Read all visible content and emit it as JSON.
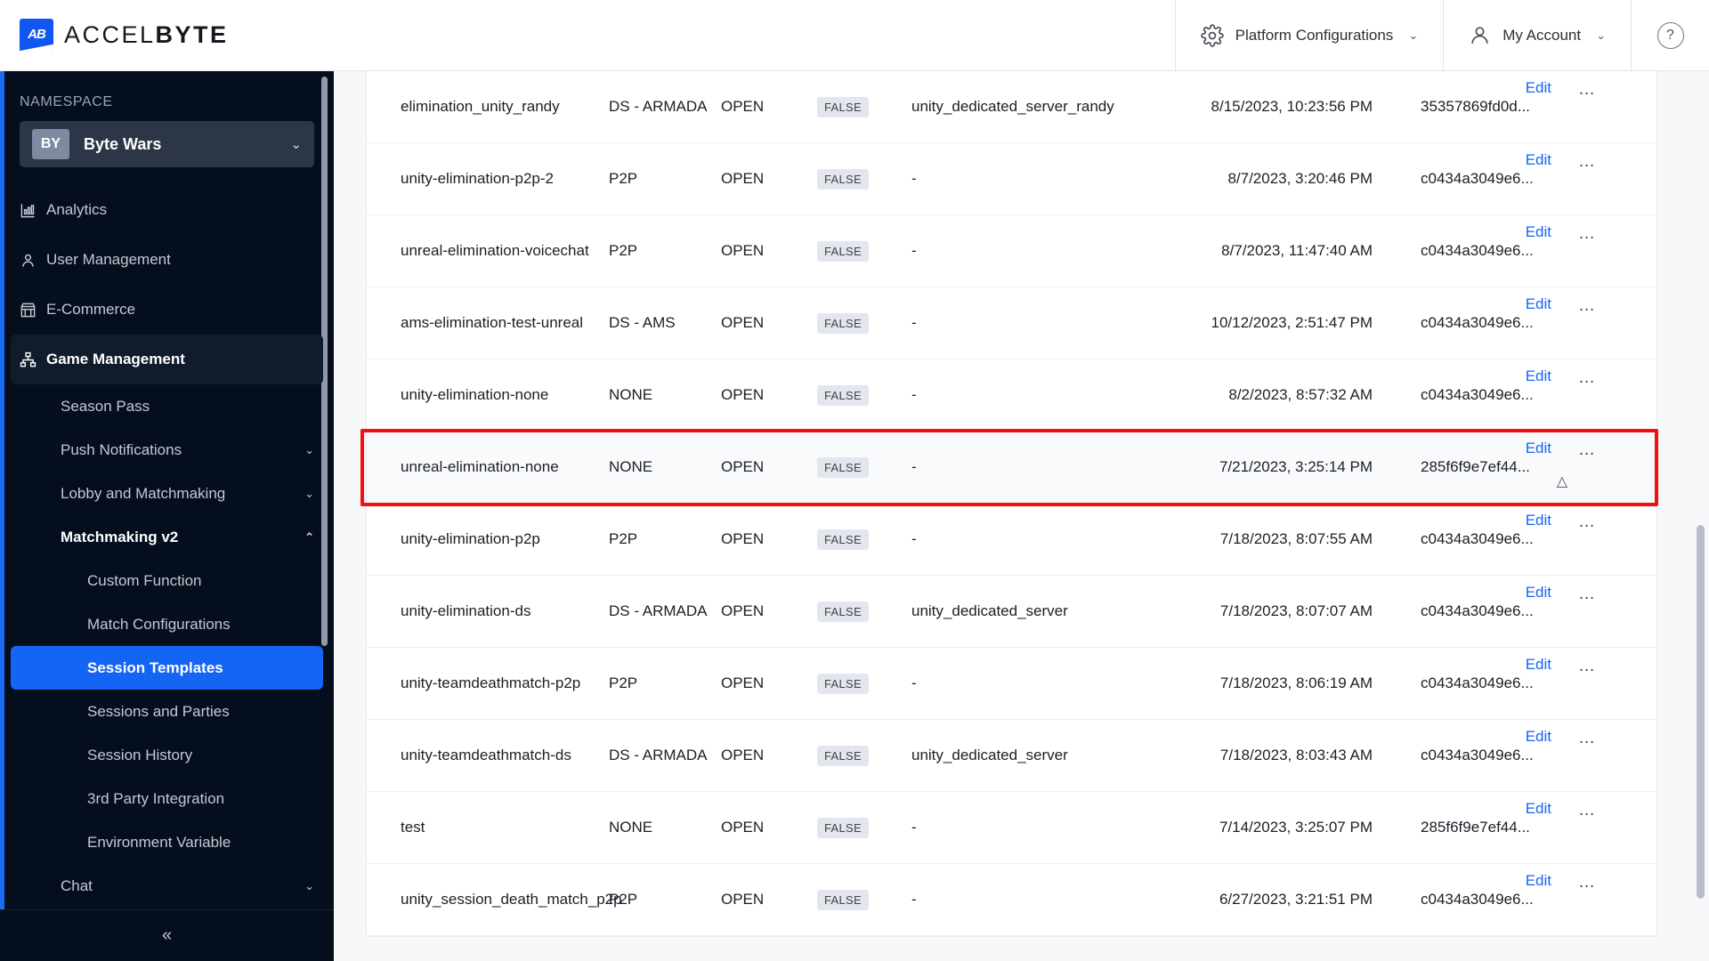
{
  "header": {
    "logo_text_light": "ACCEL",
    "logo_text_bold": "BYTE",
    "logo_mark": "AB",
    "platform_configurations": "Platform Configurations",
    "my_account": "My Account",
    "help": "?",
    "chevron": "⌄"
  },
  "sidebar": {
    "namespace_label": "NAMESPACE",
    "namespace_badge": "BY",
    "namespace_name": "Byte Wars",
    "chevron_down": "⌄",
    "chevron_up": "⌃",
    "nav": [
      {
        "label": "Analytics",
        "icon": "bar-chart-icon"
      },
      {
        "label": "User Management",
        "icon": "user-icon"
      },
      {
        "label": "E-Commerce",
        "icon": "store-icon"
      },
      {
        "label": "Game Management",
        "icon": "sitemap-icon",
        "active": true
      }
    ],
    "sub_items": [
      {
        "label": "Season Pass",
        "expandable": false
      },
      {
        "label": "Push Notifications",
        "expandable": true,
        "expanded": false
      },
      {
        "label": "Lobby and Matchmaking",
        "expandable": true,
        "expanded": false
      },
      {
        "label": "Matchmaking v2",
        "expandable": true,
        "expanded": true
      }
    ],
    "matchmaking_children": [
      {
        "label": "Custom Function",
        "selected": false
      },
      {
        "label": "Match Configurations",
        "selected": false
      },
      {
        "label": "Session Templates",
        "selected": true
      },
      {
        "label": "Sessions and Parties",
        "selected": false
      },
      {
        "label": "Session History",
        "selected": false
      },
      {
        "label": "3rd Party Integration",
        "selected": false
      },
      {
        "label": "Environment Variable",
        "selected": false
      }
    ],
    "trailing": [
      {
        "label": "Chat",
        "expandable": true
      }
    ],
    "collapse_icon": "«"
  },
  "table": {
    "edit_label": "Edit",
    "more_label": "…",
    "rows": [
      {
        "name": "elimination_unity_randy",
        "type": "DS - ARMADA",
        "join": "OPEN",
        "flag": "FALSE",
        "server": "unity_dedicated_server_randy",
        "date": "8/15/2023, 10:23:56 PM",
        "id": "35357869fd0d...",
        "highlight": false
      },
      {
        "name": "unity-elimination-p2p-2",
        "type": "P2P",
        "join": "OPEN",
        "flag": "FALSE",
        "server": "-",
        "date": "8/7/2023, 3:20:46 PM",
        "id": "c0434a3049e6...",
        "highlight": false
      },
      {
        "name": "unreal-elimination-voicechat",
        "type": "P2P",
        "join": "OPEN",
        "flag": "FALSE",
        "server": "-",
        "date": "8/7/2023, 11:47:40 AM",
        "id": "c0434a3049e6...",
        "highlight": false
      },
      {
        "name": "ams-elimination-test-unreal",
        "type": "DS - AMS",
        "join": "OPEN",
        "flag": "FALSE",
        "server": "-",
        "date": "10/12/2023, 2:51:47 PM",
        "id": "c0434a3049e6...",
        "highlight": false
      },
      {
        "name": "unity-elimination-none",
        "type": "NONE",
        "join": "OPEN",
        "flag": "FALSE",
        "server": "-",
        "date": "8/2/2023, 8:57:32 AM",
        "id": "c0434a3049e6...",
        "highlight": false
      },
      {
        "name": "unreal-elimination-none",
        "type": "NONE",
        "join": "OPEN",
        "flag": "FALSE",
        "server": "-",
        "date": "7/21/2023, 3:25:14 PM",
        "id": "285f6f9e7ef44...",
        "highlight": true
      },
      {
        "name": "unity-elimination-p2p",
        "type": "P2P",
        "join": "OPEN",
        "flag": "FALSE",
        "server": "-",
        "date": "7/18/2023, 8:07:55 AM",
        "id": "c0434a3049e6...",
        "highlight": false
      },
      {
        "name": "unity-elimination-ds",
        "type": "DS - ARMADA",
        "join": "OPEN",
        "flag": "FALSE",
        "server": "unity_dedicated_server",
        "date": "7/18/2023, 8:07:07 AM",
        "id": "c0434a3049e6...",
        "highlight": false
      },
      {
        "name": "unity-teamdeathmatch-p2p",
        "type": "P2P",
        "join": "OPEN",
        "flag": "FALSE",
        "server": "-",
        "date": "7/18/2023, 8:06:19 AM",
        "id": "c0434a3049e6...",
        "highlight": false
      },
      {
        "name": "unity-teamdeathmatch-ds",
        "type": "DS - ARMADA",
        "join": "OPEN",
        "flag": "FALSE",
        "server": "unity_dedicated_server",
        "date": "7/18/2023, 8:03:43 AM",
        "id": "c0434a3049e6...",
        "highlight": false
      },
      {
        "name": "test",
        "type": "NONE",
        "join": "OPEN",
        "flag": "FALSE",
        "server": "-",
        "date": "7/14/2023, 3:25:07 PM",
        "id": "285f6f9e7ef44...",
        "highlight": false
      },
      {
        "name": "unity_session_death_match_p2p",
        "type": "P2P",
        "join": "OPEN",
        "flag": "FALSE",
        "server": "-",
        "date": "6/27/2023, 3:21:51 PM",
        "id": "c0434a3049e6...",
        "highlight": false
      }
    ]
  },
  "colors": {
    "accent_blue": "#1565f5",
    "sidebar_bg": "#050e1c",
    "highlight_red": "#ee1111"
  }
}
